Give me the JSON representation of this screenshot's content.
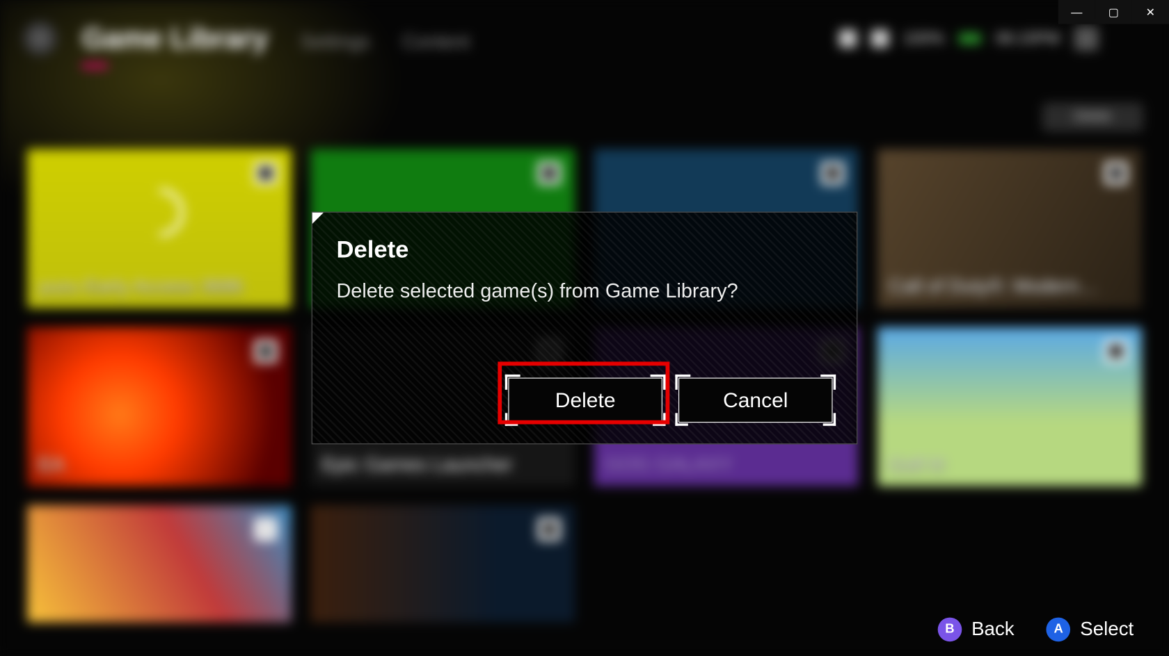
{
  "header": {
    "tabs": {
      "library": "Game Library",
      "settings": "Settings",
      "content": "Content"
    },
    "battery": "100%",
    "clock": "06:15PM"
  },
  "toolbar": {
    "delete_chip": "Delete"
  },
  "tiles": {
    "yuzu": "yuzu Early Access 3686",
    "ea": "EA",
    "epic": "Epic Games Launcher",
    "gog": "GOG GALAXY",
    "cod": "Call of Duty®: Modern…",
    "golf": "Golf It!"
  },
  "modal": {
    "title": "Delete",
    "message": "Delete selected game(s) from Game Library?",
    "delete_btn": "Delete",
    "cancel_btn": "Cancel"
  },
  "hints": {
    "back": "Back",
    "select": "Select"
  },
  "win": {
    "min": "—",
    "max": "▢",
    "close": "✕"
  },
  "badges": {
    "b": "B",
    "a": "A"
  }
}
